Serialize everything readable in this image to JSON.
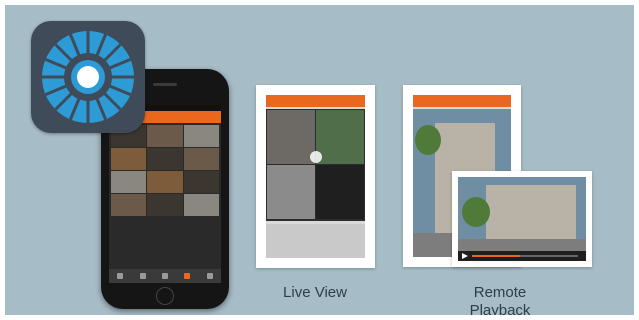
{
  "captions": {
    "live_view": "Live View",
    "remote_line1": "Remote",
    "remote_line2": "Playback"
  },
  "icons": {
    "app_icon": "camera-app-icon",
    "dial": "segmented-dial-icon"
  },
  "colors": {
    "background": "#a6bcc6",
    "icon_tile": "#3f4b59",
    "icon_accent": "#2c9bd6",
    "app_header": "#e9671f"
  },
  "playback": {
    "progress": 0.45
  }
}
